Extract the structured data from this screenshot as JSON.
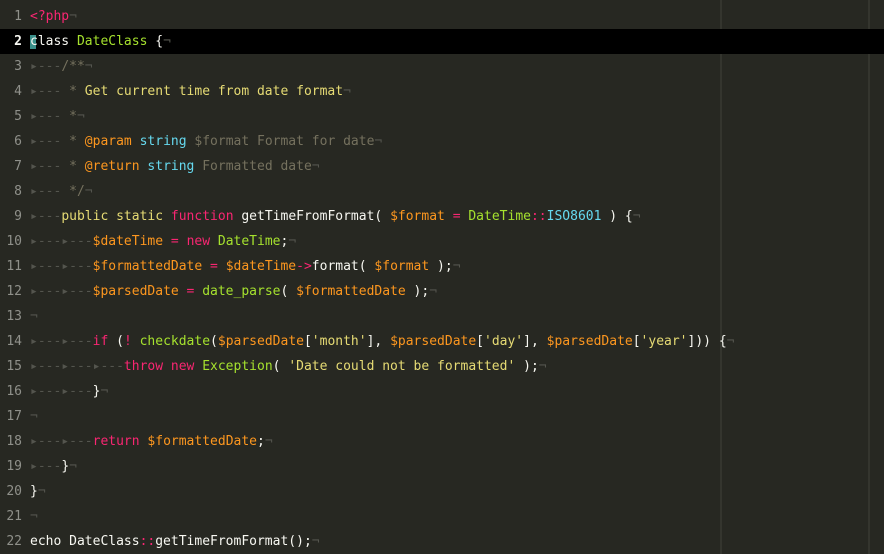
{
  "editor": {
    "active_line": 2,
    "colors": {
      "background": "#272822",
      "active_line": "#000000",
      "keyword": "#f92672",
      "function": "#a6e22e",
      "type": "#66d9ef",
      "string": "#e6db74",
      "variable": "#fd971f",
      "comment": "#75715e",
      "whitespace": "#54554e"
    },
    "lines": [
      {
        "n": "1",
        "t": [
          [
            "tag",
            "<?php"
          ],
          [
            "ws",
            "¬"
          ]
        ]
      },
      {
        "n": "2",
        "t": [
          [
            "pl",
            "class "
          ],
          [
            "cls",
            "DateClass"
          ],
          [
            "pl",
            " {"
          ],
          [
            "ws",
            "¬"
          ]
        ]
      },
      {
        "n": "3",
        "t": [
          [
            "ws",
            "▸---"
          ],
          [
            "com",
            "/**"
          ],
          [
            "ws",
            "¬"
          ]
        ]
      },
      {
        "n": "4",
        "t": [
          [
            "ws",
            "▸---"
          ],
          [
            "com",
            " * "
          ],
          [
            "yel",
            "Get current time from date format"
          ],
          [
            "ws",
            "¬"
          ]
        ]
      },
      {
        "n": "5",
        "t": [
          [
            "ws",
            "▸---"
          ],
          [
            "com",
            " *"
          ],
          [
            "ws",
            "¬"
          ]
        ]
      },
      {
        "n": "6",
        "t": [
          [
            "ws",
            "▸---"
          ],
          [
            "com",
            " * "
          ],
          [
            "var",
            "@param"
          ],
          [
            "pl",
            " "
          ],
          [
            "ty",
            "string"
          ],
          [
            "com",
            " $format Format for date"
          ],
          [
            "ws",
            "¬"
          ]
        ]
      },
      {
        "n": "7",
        "t": [
          [
            "ws",
            "▸---"
          ],
          [
            "com",
            " * "
          ],
          [
            "var",
            "@return"
          ],
          [
            "pl",
            " "
          ],
          [
            "ty",
            "string"
          ],
          [
            "com",
            " Formatted date"
          ],
          [
            "ws",
            "¬"
          ]
        ]
      },
      {
        "n": "8",
        "t": [
          [
            "ws",
            "▸---"
          ],
          [
            "com",
            " */"
          ],
          [
            "ws",
            "¬"
          ]
        ]
      },
      {
        "n": "9",
        "t": [
          [
            "ws",
            "▸---"
          ],
          [
            "yel",
            "public"
          ],
          [
            "pl",
            " "
          ],
          [
            "yel",
            "static"
          ],
          [
            "pl",
            " "
          ],
          [
            "kw",
            "function"
          ],
          [
            "pl",
            " getTimeFromFormat( "
          ],
          [
            "var",
            "$format"
          ],
          [
            "pl",
            " "
          ],
          [
            "op",
            "="
          ],
          [
            "pl",
            " "
          ],
          [
            "cls",
            "DateTime"
          ],
          [
            "op",
            "::"
          ],
          [
            "ty",
            "ISO8601"
          ],
          [
            "pl",
            " ) {"
          ],
          [
            "ws",
            "¬"
          ]
        ]
      },
      {
        "n": "10",
        "t": [
          [
            "ws",
            "▸---▸---"
          ],
          [
            "var",
            "$dateTime"
          ],
          [
            "pl",
            " "
          ],
          [
            "op",
            "="
          ],
          [
            "pl",
            " "
          ],
          [
            "kw",
            "new"
          ],
          [
            "pl",
            " "
          ],
          [
            "cls",
            "DateTime"
          ],
          [
            "pl",
            ";"
          ],
          [
            "ws",
            "¬"
          ]
        ]
      },
      {
        "n": "11",
        "t": [
          [
            "ws",
            "▸---▸---"
          ],
          [
            "var",
            "$formattedDate"
          ],
          [
            "pl",
            " "
          ],
          [
            "op",
            "="
          ],
          [
            "pl",
            " "
          ],
          [
            "var",
            "$dateTime"
          ],
          [
            "op",
            "->"
          ],
          [
            "pl",
            "format( "
          ],
          [
            "var",
            "$format"
          ],
          [
            "pl",
            " );"
          ],
          [
            "ws",
            "¬"
          ]
        ]
      },
      {
        "n": "12",
        "t": [
          [
            "ws",
            "▸---▸---"
          ],
          [
            "var",
            "$parsedDate"
          ],
          [
            "pl",
            " "
          ],
          [
            "op",
            "="
          ],
          [
            "pl",
            " "
          ],
          [
            "fn",
            "date_parse"
          ],
          [
            "pl",
            "( "
          ],
          [
            "var",
            "$formattedDate"
          ],
          [
            "pl",
            " );"
          ],
          [
            "ws",
            "¬"
          ]
        ]
      },
      {
        "n": "13",
        "t": [
          [
            "ws",
            "¬"
          ]
        ]
      },
      {
        "n": "14",
        "t": [
          [
            "ws",
            "▸---▸---"
          ],
          [
            "kw",
            "if"
          ],
          [
            "pl",
            " ("
          ],
          [
            "op",
            "!"
          ],
          [
            "pl",
            " "
          ],
          [
            "fn",
            "checkdate"
          ],
          [
            "pl",
            "("
          ],
          [
            "var",
            "$parsedDate"
          ],
          [
            "pl",
            "["
          ],
          [
            "str",
            "'month'"
          ],
          [
            "pl",
            "], "
          ],
          [
            "var",
            "$parsedDate"
          ],
          [
            "pl",
            "["
          ],
          [
            "str",
            "'day'"
          ],
          [
            "pl",
            "], "
          ],
          [
            "var",
            "$parsedDate"
          ],
          [
            "pl",
            "["
          ],
          [
            "str",
            "'year'"
          ],
          [
            "pl",
            "])) {"
          ],
          [
            "ws",
            "¬"
          ]
        ]
      },
      {
        "n": "15",
        "t": [
          [
            "ws",
            "▸---▸---▸---"
          ],
          [
            "kw",
            "throw"
          ],
          [
            "pl",
            " "
          ],
          [
            "kw",
            "new"
          ],
          [
            "pl",
            " "
          ],
          [
            "cls",
            "Exception"
          ],
          [
            "pl",
            "( "
          ],
          [
            "str",
            "'Date could not be formatted'"
          ],
          [
            "pl",
            " );"
          ],
          [
            "ws",
            "¬"
          ]
        ]
      },
      {
        "n": "16",
        "t": [
          [
            "ws",
            "▸---▸---"
          ],
          [
            "pl",
            "}"
          ],
          [
            "ws",
            "¬"
          ]
        ]
      },
      {
        "n": "17",
        "t": [
          [
            "ws",
            "¬"
          ]
        ]
      },
      {
        "n": "18",
        "t": [
          [
            "ws",
            "▸---▸---"
          ],
          [
            "kw",
            "return"
          ],
          [
            "pl",
            " "
          ],
          [
            "var",
            "$formattedDate"
          ],
          [
            "pl",
            ";"
          ],
          [
            "ws",
            "¬"
          ]
        ]
      },
      {
        "n": "19",
        "t": [
          [
            "ws",
            "▸---"
          ],
          [
            "pl",
            "}"
          ],
          [
            "ws",
            "¬"
          ]
        ]
      },
      {
        "n": "20",
        "t": [
          [
            "pl",
            "}"
          ],
          [
            "ws",
            "¬"
          ]
        ]
      },
      {
        "n": "21",
        "t": [
          [
            "ws",
            "¬"
          ]
        ]
      },
      {
        "n": "22",
        "t": [
          [
            "pl",
            "echo DateClass"
          ],
          [
            "op",
            "::"
          ],
          [
            "pl",
            "getTimeFromFormat();"
          ],
          [
            "ws",
            "¬"
          ]
        ]
      }
    ]
  }
}
